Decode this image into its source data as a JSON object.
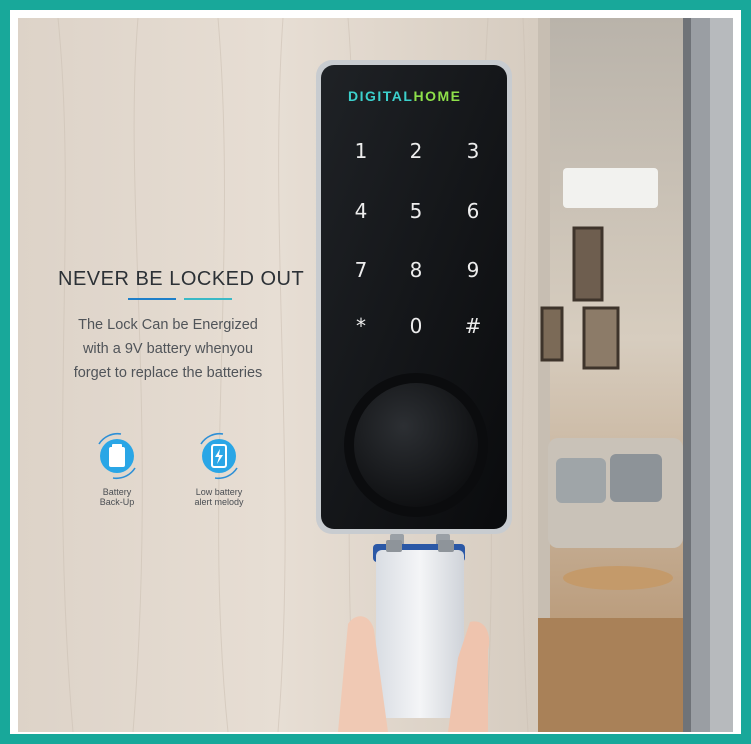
{
  "brand": {
    "part_a": "DIGITAL",
    "part_b": "HOME"
  },
  "headline": "NEVER BE LOCKED OUT",
  "body_lines": [
    "The Lock Can be Energized",
    "with a 9V battery whenyou",
    "forget to replace the batteries"
  ],
  "badges": [
    {
      "icon": "battery-backup-icon",
      "label_lines": [
        "Battery",
        "Back-Up"
      ]
    },
    {
      "icon": "low-battery-alert-icon",
      "label_lines": [
        "Low battery",
        "alert melody"
      ]
    }
  ],
  "keypad": [
    "1",
    "2",
    "3",
    "4",
    "5",
    "6",
    "7",
    "8",
    "9",
    "*",
    "0",
    "#"
  ],
  "colors": {
    "frame": "#18a89a",
    "accent_blue": "#1e7fc9",
    "accent_cyan": "#3ab9c6",
    "brand_cyan": "#3cd0cc",
    "brand_green": "#8ee04a"
  }
}
